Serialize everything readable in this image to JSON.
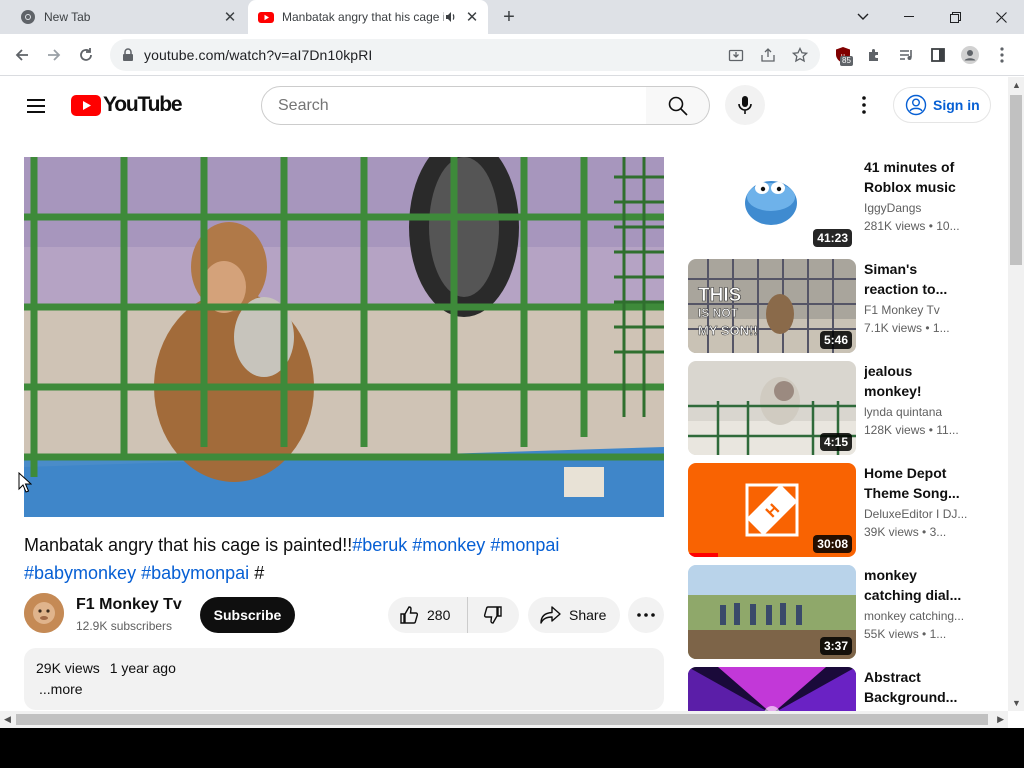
{
  "browser": {
    "tabs": [
      {
        "title": "New Tab"
      },
      {
        "title": "Manbatak angry that his cage is painted!!#beruk #monkey #monpai #babymonkey #babymonpai # - YouTube"
      }
    ],
    "url": "youtube.com/watch?v=aI7Dn10kpRI",
    "extension_badge": "85"
  },
  "header": {
    "logo_text": "YouTube",
    "search_placeholder": "Search",
    "sign_in_label": "Sign in"
  },
  "video": {
    "title_main": "Manbatak angry that his cage is painted!!",
    "hashtags": [
      "#beruk",
      "#monkey",
      "#monpai",
      "#babymonkey",
      "#babymonpai"
    ],
    "title_tail": "#",
    "channel": "F1 Monkey Tv",
    "subscribers": "12.9K subscribers",
    "subscribe_label": "Subscribe",
    "likes": "280",
    "share_label": "Share",
    "views": "29K views",
    "age": "1 year ago",
    "more_label": "...more"
  },
  "recommendations": [
    {
      "title": "41 minutes of Roblox music",
      "channel": "IggyDangs",
      "views": "281K views",
      "age": "• 10...",
      "duration": "41:23"
    },
    {
      "title": "Siman's reaction to...",
      "channel": "F1 Monkey Tv",
      "views": "7.1K views",
      "age": "• 1...",
      "duration": "5:46",
      "overlay_text": "THIS IS NOT MY SON!!"
    },
    {
      "title": "jealous monkey!",
      "channel": "lynda quintana",
      "views": "128K views",
      "age": "• 11...",
      "duration": "4:15"
    },
    {
      "title": "Home Depot Theme Song...",
      "channel": "DeluxeEditor I DJ...",
      "views": "39K views",
      "age": "• 3...",
      "duration": "30:08"
    },
    {
      "title": "monkey catching dial...",
      "channel": "monkey catching...",
      "views": "55K views",
      "age": "• 1...",
      "duration": "3:37"
    },
    {
      "title": "Abstract Background...",
      "channel": "",
      "views": "",
      "age": "",
      "duration": ""
    }
  ],
  "colors": {
    "youtube_red": "#ff0000",
    "link_blue": "#065fd4",
    "tab_strip": "#dee1e6"
  }
}
